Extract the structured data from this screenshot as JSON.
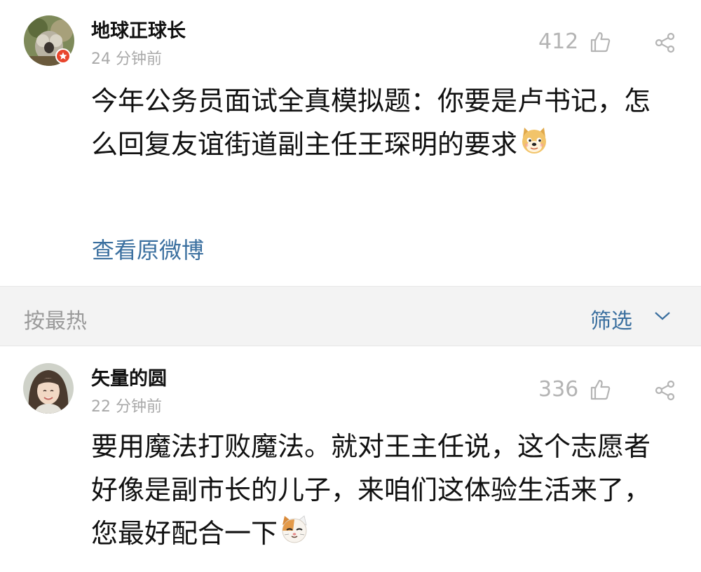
{
  "post": {
    "username": "地球正球长",
    "time": "24 分钟前",
    "likes": "412",
    "content": "今年公务员面试全真模拟题：你要是卢书记，怎么回复友谊街道副主任王琛明的要求",
    "view_original": "查看原微博"
  },
  "sort_bar": {
    "sort_label": "按最热",
    "filter_label": "筛选"
  },
  "comment": {
    "username": "矢量的圆",
    "time": "22 分钟前",
    "likes": "336",
    "content": "要用魔法打败魔法。就对王主任说，这个志愿者好像是副市长的儿子，来咱们这体验生活来了，您最好配合一下"
  },
  "icons": {
    "like": "thumb-up-icon",
    "share": "share-icon",
    "filter_dropdown": "chevron-down-icon",
    "verified_badge": "star-badge-icon",
    "doge": "doge-emoji-icon",
    "cat": "cat-emoji-icon"
  },
  "colors": {
    "link": "#3a6f9f",
    "muted": "#a9a9a9",
    "sort_bar_bg": "#f3f3f3",
    "badge": "#e8452c"
  }
}
